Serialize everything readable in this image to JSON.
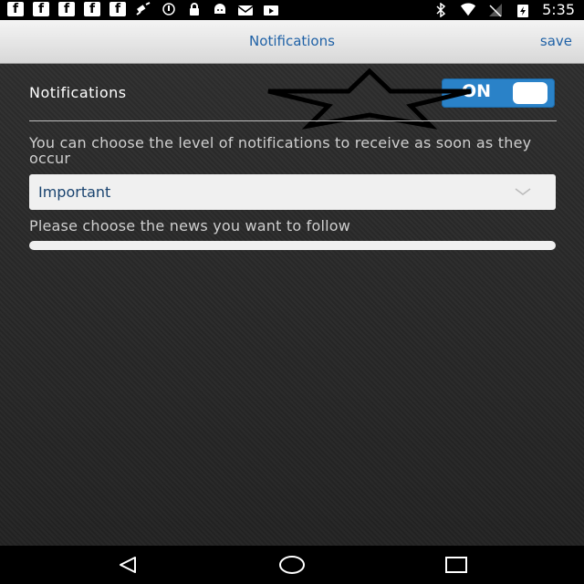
{
  "status_bar": {
    "time": "5:35",
    "left_icons": [
      "facebook-icon",
      "facebook-icon",
      "facebook-icon",
      "facebook-icon",
      "facebook-icon",
      "satellite-icon",
      "circle-info-icon",
      "lock-icon",
      "android-icon",
      "mail-icon",
      "media-icon"
    ],
    "right_icons": [
      "bluetooth-icon",
      "wifi-icon",
      "no-signal-icon",
      "battery-charging-icon"
    ],
    "fb_glyph": "f"
  },
  "header": {
    "title": "Notifications",
    "save_label": "save"
  },
  "notifications": {
    "label": "Notifications",
    "toggle_label": "ON",
    "toggle_state": "on",
    "description": "You can choose the level of notifications to receive as soon as they occur",
    "level_selected": "Important",
    "follow_label": "Please choose the news you want to follow"
  },
  "nav_bar": {
    "icons": [
      "back-icon",
      "home-icon",
      "recents-icon"
    ]
  },
  "colors": {
    "accent": "#1f61a6",
    "toggle_bg": "#2a82c8",
    "background": "#2a2a2a"
  }
}
